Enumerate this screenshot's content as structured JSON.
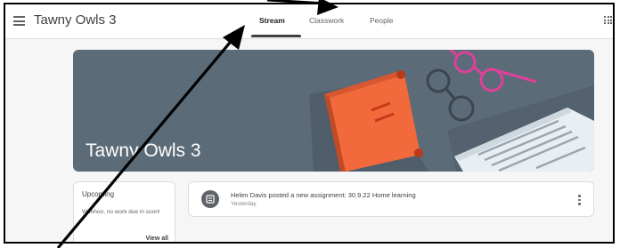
{
  "header": {
    "class_name": "Tawny Owls 3",
    "tabs": [
      {
        "label": "Stream",
        "active": true
      },
      {
        "label": "Classwork",
        "active": false
      },
      {
        "label": "People",
        "active": false
      }
    ],
    "menu_icon": "hamburger-icon",
    "apps_icon": "apps-grid-icon"
  },
  "banner": {
    "title": "Tawny Owls 3",
    "theme_color": "#5b6b78"
  },
  "upcoming": {
    "title": "Upcoming",
    "text": "Woohoo, no work due in soon!",
    "link": "View all"
  },
  "stream": {
    "posts": [
      {
        "text": "Helen Davis posted a new assignment: 30.9.22 Home learning",
        "date": "Yesterday",
        "icon": "assignment-icon"
      }
    ]
  },
  "annotations": {
    "arrow_color": "#000000",
    "arrow_count": 2
  }
}
